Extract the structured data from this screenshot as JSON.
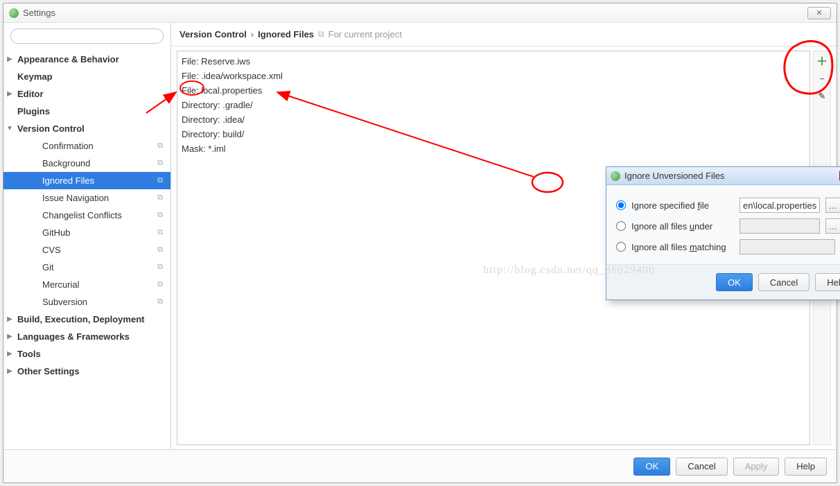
{
  "titlebar": {
    "title": "Settings"
  },
  "search": {
    "placeholder": ""
  },
  "sidebar": {
    "items": [
      {
        "label": "Appearance & Behavior",
        "bold": true,
        "caret": "right"
      },
      {
        "label": "Keymap",
        "bold": true,
        "caret": "none"
      },
      {
        "label": "Editor",
        "bold": true,
        "caret": "right"
      },
      {
        "label": "Plugins",
        "bold": true,
        "caret": "none"
      },
      {
        "label": "Version Control",
        "bold": true,
        "caret": "down"
      },
      {
        "label": "Confirmation",
        "indent": 2,
        "copy": true
      },
      {
        "label": "Background",
        "indent": 2,
        "copy": true
      },
      {
        "label": "Ignored Files",
        "indent": 2,
        "copy": true,
        "selected": true
      },
      {
        "label": "Issue Navigation",
        "indent": 2,
        "copy": true
      },
      {
        "label": "Changelist Conflicts",
        "indent": 2,
        "copy": true
      },
      {
        "label": "GitHub",
        "indent": 2,
        "copy": true
      },
      {
        "label": "CVS",
        "indent": 2,
        "copy": true
      },
      {
        "label": "Git",
        "indent": 2,
        "copy": true
      },
      {
        "label": "Mercurial",
        "indent": 2,
        "copy": true
      },
      {
        "label": "Subversion",
        "indent": 2,
        "copy": true
      },
      {
        "label": "Build, Execution, Deployment",
        "bold": true,
        "caret": "right"
      },
      {
        "label": "Languages & Frameworks",
        "bold": true,
        "caret": "right"
      },
      {
        "label": "Tools",
        "bold": true,
        "caret": "right"
      },
      {
        "label": "Other Settings",
        "bold": true,
        "caret": "right"
      }
    ]
  },
  "breadcrumb": {
    "part1": "Version Control",
    "part2": "Ignored Files",
    "scope": "For current project"
  },
  "list": {
    "rows": [
      "File: Reserve.iws",
      "File: .idea/workspace.xml",
      "File: local.properties",
      "Directory: .gradle/",
      "Directory: .idea/",
      "Directory: build/",
      "Mask: *.iml"
    ]
  },
  "dialog": {
    "title": "Ignore Unversioned Files",
    "option_file": "Ignore specified file",
    "option_under": "Ignore all files under",
    "option_matching": "Ignore all files matching",
    "file_value": "en\\local.properties",
    "under_value": "",
    "matching_value": "",
    "ok": "OK",
    "cancel": "Cancel",
    "help": "Help"
  },
  "footer": {
    "ok": "OK",
    "cancel": "Cancel",
    "apply": "Apply",
    "help": "Help"
  },
  "watermark": "http://blog.csdn.net/qq_36029400"
}
